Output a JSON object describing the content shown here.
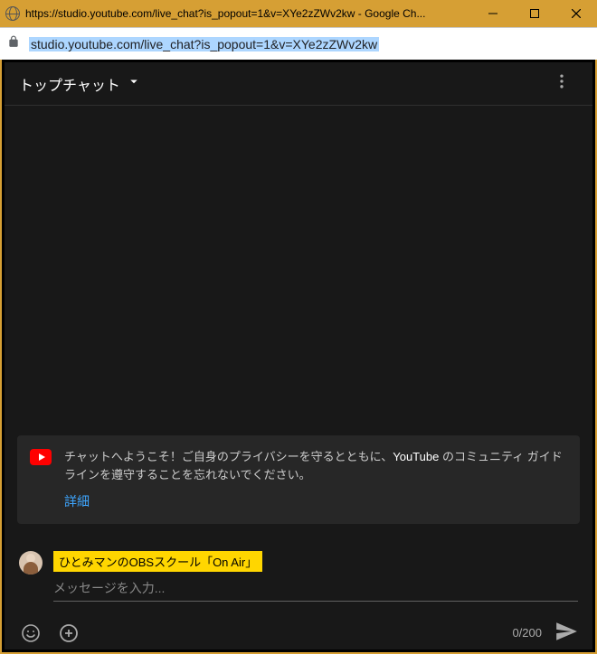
{
  "window": {
    "title": "https://studio.youtube.com/live_chat?is_popout=1&v=XYe2zZWv2kw - Google Ch..."
  },
  "address_bar": {
    "url": "studio.youtube.com/live_chat?is_popout=1&v=XYe2zZWv2kw"
  },
  "header": {
    "mode_label": "トップチャット"
  },
  "welcome": {
    "text_before": "チャットへようこそ！ご自身のプライバシーを守るとともに、",
    "text_strong": "YouTube",
    "text_after": " のコミュニティ ガイドラインを遵守することを忘れないでください。",
    "details_label": "詳細"
  },
  "composer": {
    "user_badge": "ひとみマンのOBSスクール「On Air」",
    "placeholder": "メッセージを入力...",
    "value": "",
    "char_count": "0/200"
  }
}
